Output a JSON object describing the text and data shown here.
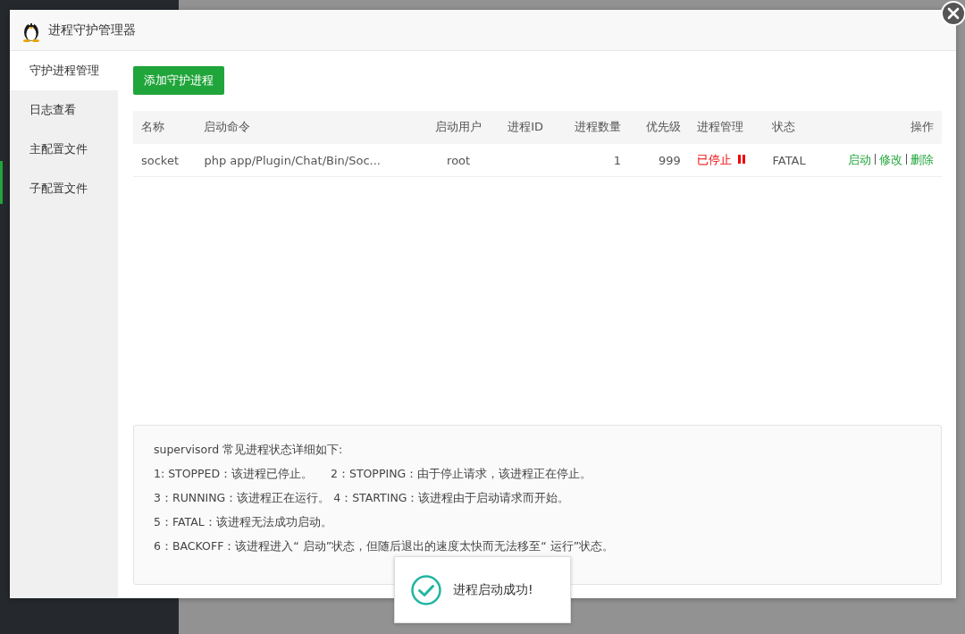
{
  "window": {
    "title": "进程守护管理器"
  },
  "sidebar": {
    "items": [
      {
        "label": "守护进程管理",
        "selected": true
      },
      {
        "label": "日志查看",
        "selected": false
      },
      {
        "label": "主配置文件",
        "selected": false
      },
      {
        "label": "子配置文件",
        "selected": false
      }
    ]
  },
  "add_button": "添加守护进程",
  "table": {
    "columns": [
      "名称",
      "启动命令",
      "启动用户",
      "进程ID",
      "进程数量",
      "优先级",
      "进程管理",
      "状态",
      "操作"
    ],
    "rows": [
      {
        "name": "socket",
        "command": "php app/Plugin/Chat/Bin/Soc...",
        "user": "root",
        "pid": "",
        "count": "1",
        "priority": "999",
        "manage": "已停止",
        "running": false,
        "status": "FATAL",
        "actions": [
          "启动",
          "修改",
          "删除"
        ]
      }
    ]
  },
  "notes": [
    "supervisord 常见进程状态详细如下:",
    "1: STOPPED：该进程已停止。     2：STOPPING：由于停止请求，该进程正在停止。",
    "3：RUNNING：该进程正在运行。 4：STARTING：该进程由于启动请求而开始。",
    "5：FATAL：该进程无法成功启动。",
    "6：BACKOFF：该进程进入“ 启动”状态，但随后退出的速度太快而无法移至“ 运行”状态。"
  ],
  "toast": {
    "message": "进程启动成功!",
    "kind": "success"
  }
}
